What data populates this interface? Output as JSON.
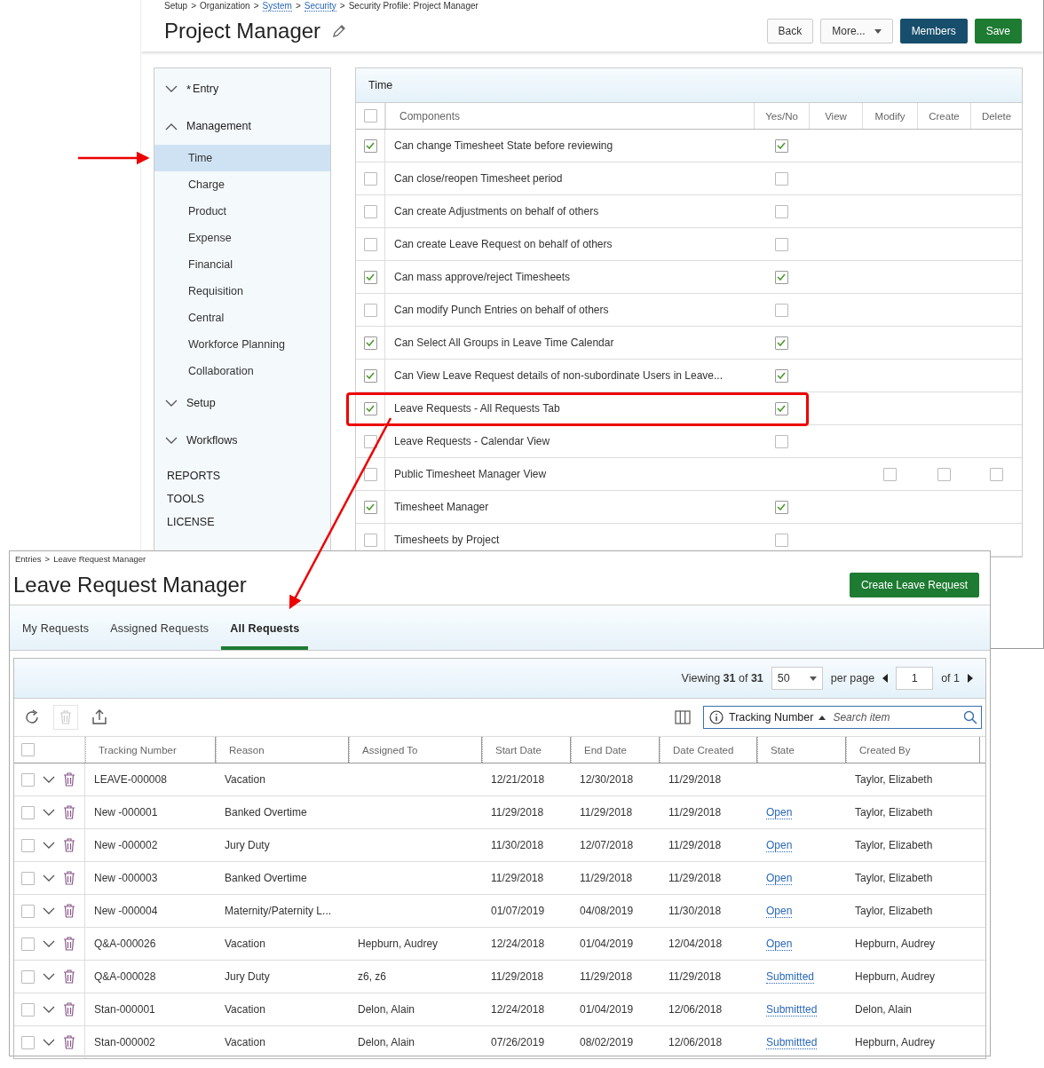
{
  "profile_screen": {
    "breadcrumb": [
      {
        "text": "Setup",
        "link": false
      },
      {
        "text": ">",
        "link": false
      },
      {
        "text": "Organization",
        "link": false
      },
      {
        "text": ">",
        "link": false
      },
      {
        "text": "System",
        "link": true
      },
      {
        "text": ">",
        "link": false
      },
      {
        "text": "Security",
        "link": true
      },
      {
        "text": ">",
        "link": false
      },
      {
        "text": "Security Profile: Project Manager",
        "link": false
      }
    ],
    "title": "Project Manager",
    "buttons": [
      {
        "label": "Back",
        "kind": "plain"
      },
      {
        "label": "More...",
        "kind": "dropdown"
      },
      {
        "label": "Members",
        "kind": "dark"
      },
      {
        "label": "Save",
        "kind": "primary"
      }
    ],
    "sidebar": [
      {
        "kind": "group",
        "label": "Entry",
        "required_mark": "*",
        "expanded": false
      },
      {
        "kind": "group",
        "label": "Management",
        "expanded": true,
        "children": [
          {
            "label": "Time",
            "selected": true
          },
          {
            "label": "Charge",
            "selected": false
          },
          {
            "label": "Product",
            "selected": false
          },
          {
            "label": "Expense",
            "selected": false
          },
          {
            "label": "Financial",
            "selected": false
          },
          {
            "label": "Requisition",
            "selected": false
          },
          {
            "label": "Central",
            "selected": false
          },
          {
            "label": "Workforce Planning",
            "selected": false
          },
          {
            "label": "Collaboration",
            "selected": false
          }
        ]
      },
      {
        "kind": "group",
        "label": "Setup",
        "expanded": false
      },
      {
        "kind": "group",
        "label": "Workflows",
        "expanded": false
      },
      {
        "kind": "section",
        "label": "REPORTS"
      },
      {
        "kind": "section",
        "label": "TOOLS"
      },
      {
        "kind": "section",
        "label": "LICENSE"
      }
    ],
    "panel": {
      "title": "Time",
      "header_checked": false,
      "columns": [
        "Components",
        "Yes/No",
        "View",
        "Modify",
        "Create",
        "Delete"
      ],
      "rows": [
        {
          "component": "Can change Timesheet State before reviewing",
          "checked": true,
          "highlighted": false,
          "yes_no": true
        },
        {
          "component": "Can close/reopen Timesheet period",
          "checked": false,
          "highlighted": false,
          "yes_no": false
        },
        {
          "component": "Can create Adjustments on behalf of others",
          "checked": false,
          "highlighted": false,
          "yes_no": false
        },
        {
          "component": "Can create Leave Request on behalf of others",
          "checked": false,
          "highlighted": false,
          "yes_no": false
        },
        {
          "component": "Can mass approve/reject Timesheets",
          "checked": true,
          "highlighted": false,
          "yes_no": true
        },
        {
          "component": "Can modify Punch Entries on behalf of others",
          "checked": false,
          "highlighted": false,
          "yes_no": false
        },
        {
          "component": "Can Select All Groups in Leave Time Calendar",
          "checked": true,
          "highlighted": false,
          "yes_no": true
        },
        {
          "component": "Can View Leave Request details of non-subordinate Users in Leave...",
          "checked": true,
          "highlighted": false,
          "yes_no": true
        },
        {
          "component": "Leave Requests - All Requests Tab",
          "checked": true,
          "highlighted": true,
          "yes_no": true
        },
        {
          "component": "Leave Requests - Calendar View",
          "checked": false,
          "highlighted": false,
          "yes_no": false
        },
        {
          "component": "Public Timesheet Manager View",
          "checked": false,
          "highlighted": false,
          "modify": false,
          "create": false,
          "delete": false
        },
        {
          "component": "Timesheet Manager",
          "checked": true,
          "highlighted": false,
          "yes_no": true
        },
        {
          "component": "Timesheets by Project",
          "checked": false,
          "highlighted": false,
          "yes_no": false
        }
      ]
    }
  },
  "leave_screen": {
    "breadcrumb": [
      {
        "text": "Entries",
        "link": false
      },
      {
        "text": ">",
        "link": false
      },
      {
        "text": "Leave Request Manager",
        "link": false
      }
    ],
    "title": "Leave Request Manager",
    "create_button": "Create Leave Request",
    "tabs": [
      {
        "label": "My Requests",
        "selected": false
      },
      {
        "label": "Assigned Requests",
        "selected": false
      },
      {
        "label": "All Requests",
        "selected": true
      }
    ],
    "pager": {
      "viewing": "Viewing **31** of **31**",
      "page_size": "50",
      "per_page": "per page",
      "page": "1",
      "of_pages": "of 1"
    },
    "search": {
      "sort_field": "Tracking Number",
      "placeholder": "Search item"
    },
    "header_checked": false,
    "columns": [
      "Tracking Number",
      "Reason",
      "Assigned To",
      "Start Date",
      "End Date",
      "Date Created",
      "State",
      "Created By"
    ],
    "rows": [
      {
        "checked": false,
        "cells": [
          "LEAVE-000008",
          "Vacation",
          "",
          "12/21/2018",
          "12/30/2018",
          "11/29/2018",
          "",
          "Taylor, Elizabeth"
        ]
      },
      {
        "checked": false,
        "cells": [
          "New -000001",
          "Banked Overtime",
          "",
          "11/29/2018",
          "11/29/2018",
          "11/29/2018",
          "Open",
          "Taylor, Elizabeth"
        ]
      },
      {
        "checked": false,
        "cells": [
          "New -000002",
          "Jury Duty",
          "",
          "11/30/2018",
          "12/07/2018",
          "11/29/2018",
          "Open",
          "Taylor, Elizabeth"
        ]
      },
      {
        "checked": false,
        "cells": [
          "New -000003",
          "Banked Overtime",
          "",
          "11/29/2018",
          "11/29/2018",
          "11/29/2018",
          "Open",
          "Taylor, Elizabeth"
        ]
      },
      {
        "checked": false,
        "cells": [
          "New -000004",
          "Maternity/Paternity L...",
          "",
          "01/07/2019",
          "04/08/2019",
          "11/30/2018",
          "Open",
          "Taylor, Elizabeth"
        ]
      },
      {
        "checked": false,
        "cells": [
          "Q&A-000026",
          "Vacation",
          "Hepburn, Audrey",
          "12/24/2018",
          "01/04/2019",
          "12/04/2018",
          "Open",
          "Hepburn, Audrey"
        ]
      },
      {
        "checked": false,
        "cells": [
          "Q&A-000028",
          "Jury Duty",
          "z6, z6",
          "11/29/2018",
          "11/29/2018",
          "11/29/2018",
          "Submitted",
          "Hepburn, Audrey"
        ]
      },
      {
        "checked": false,
        "cells": [
          "Stan-000001",
          "Vacation",
          "Delon, Alain",
          "12/24/2018",
          "01/04/2019",
          "12/06/2018",
          "Submittted",
          "Delon, Alain"
        ]
      },
      {
        "checked": false,
        "cells": [
          "Stan-000002",
          "Vacation",
          "Delon, Alain",
          "07/26/2019",
          "08/02/2019",
          "12/06/2018",
          "Submittted",
          "Hepburn, Audrey"
        ]
      }
    ]
  }
}
